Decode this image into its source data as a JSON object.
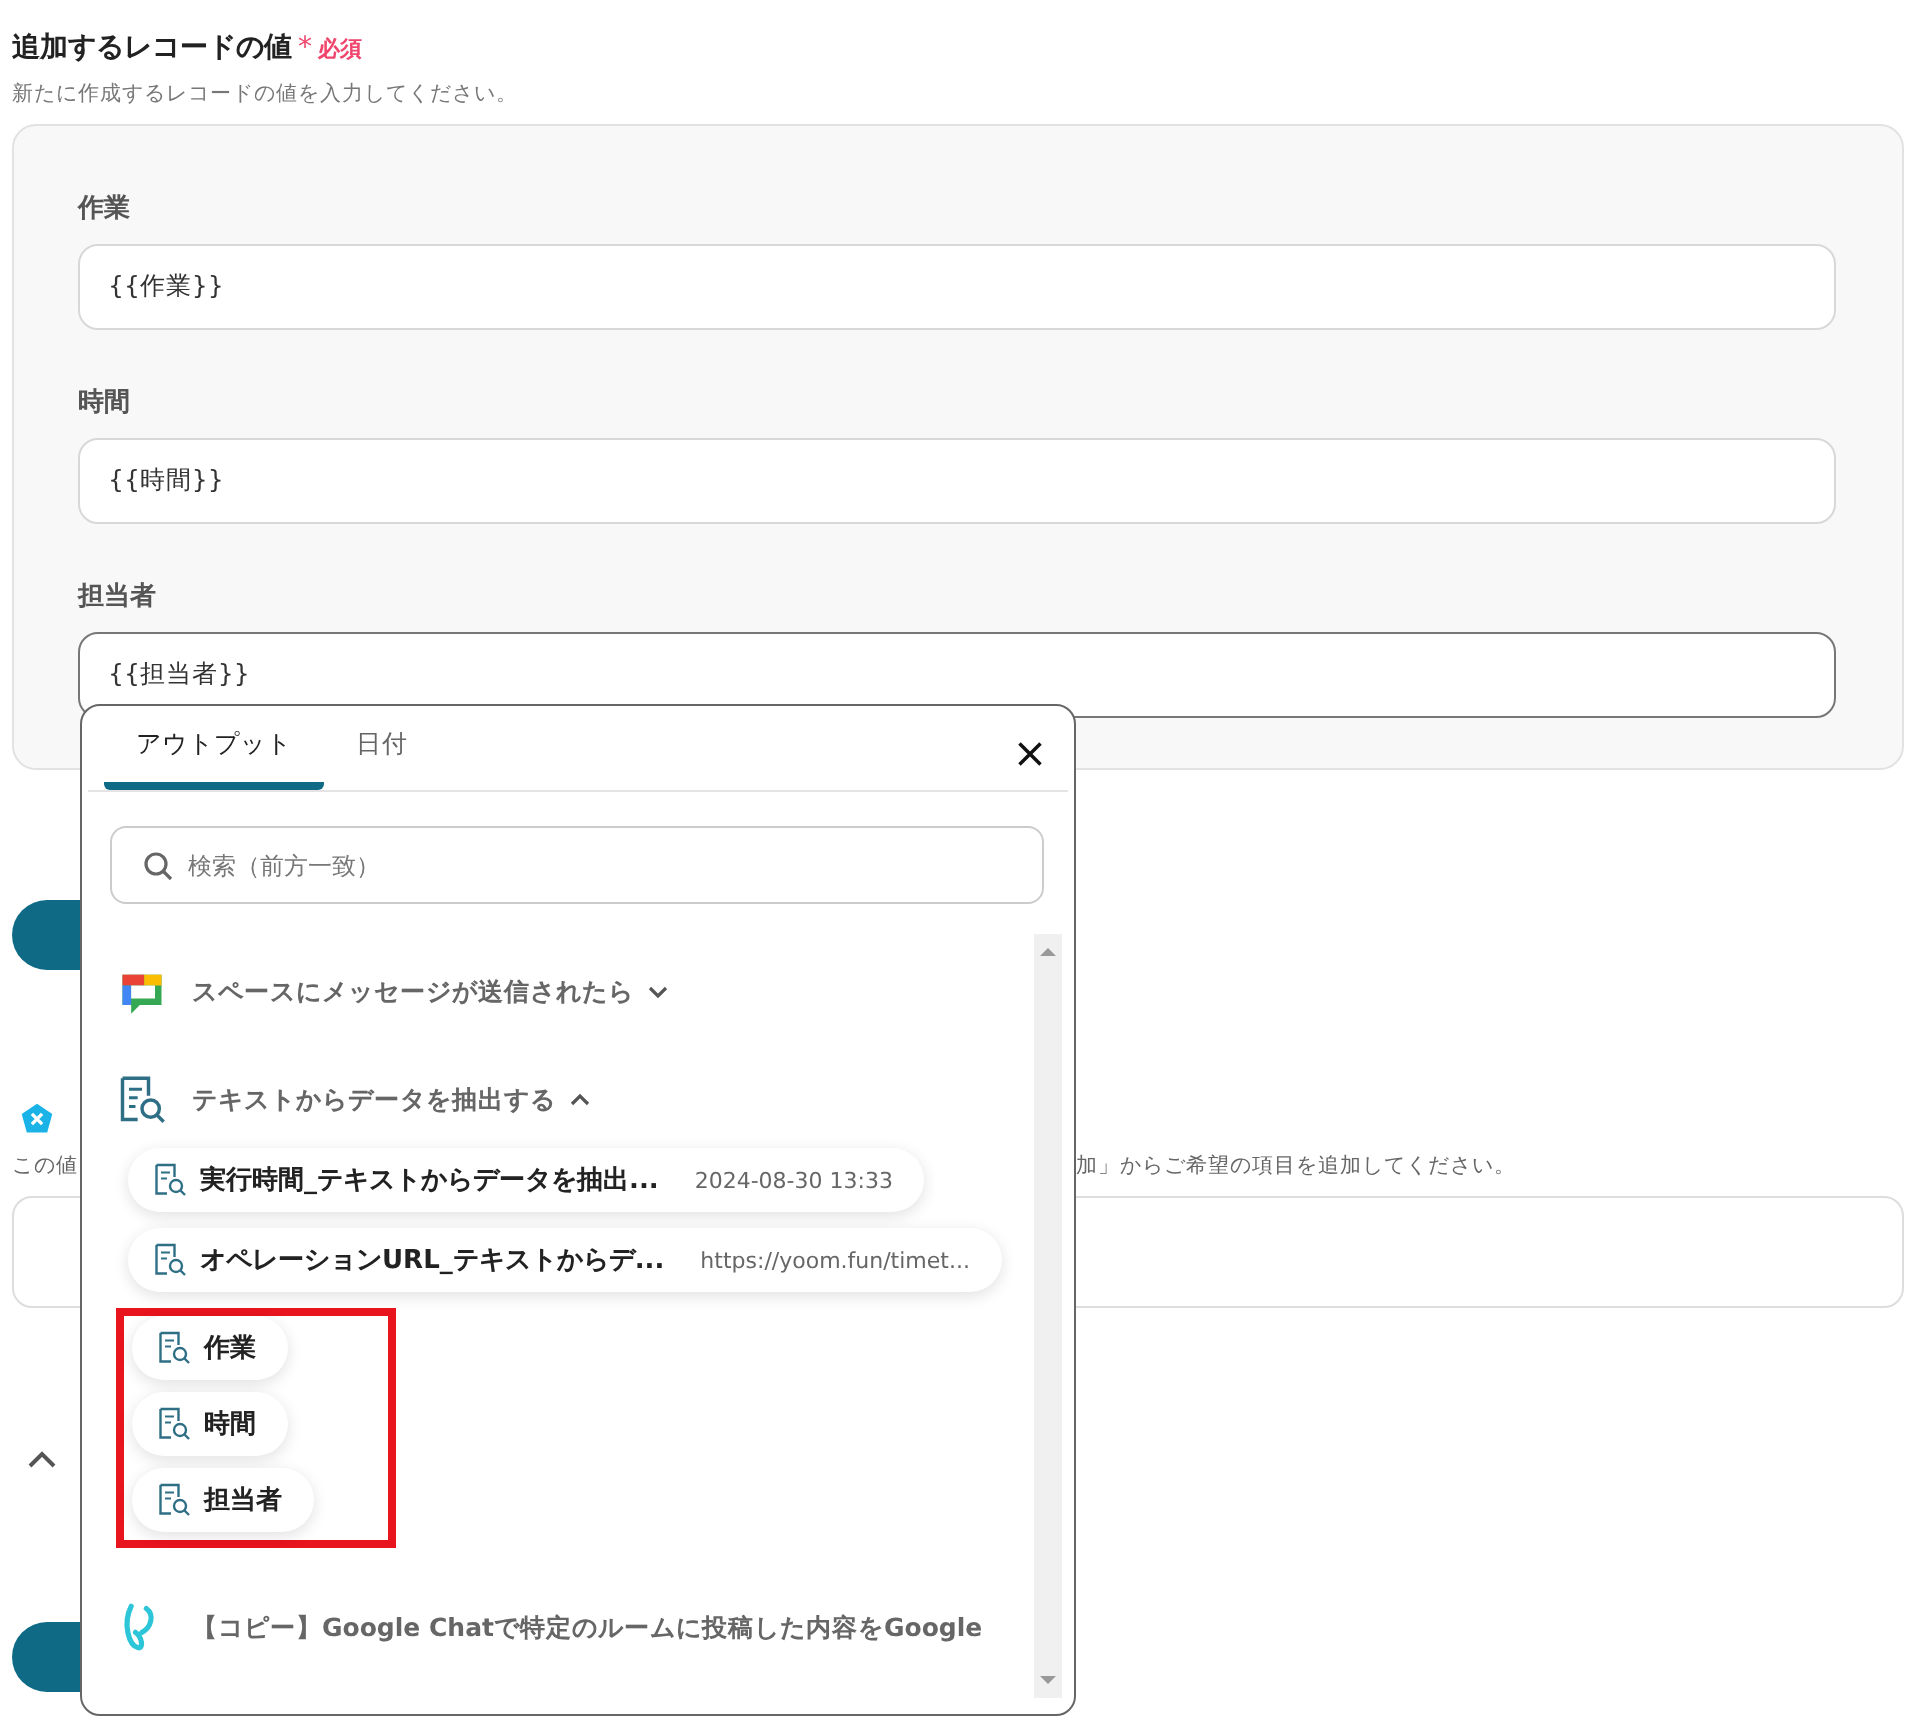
{
  "section": {
    "title": "追加するレコードの値",
    "required_mark": "*",
    "required": "必須",
    "description": "新たに作成するレコードの値を入力してください。",
    "fields": [
      {
        "label": "作業",
        "value": "{{作業}}",
        "focused": false
      },
      {
        "label": "時間",
        "value": "{{時間}}",
        "focused": false
      },
      {
        "label": "担当者",
        "value": "{{担当者}}",
        "focused": true
      }
    ]
  },
  "section2": {
    "hint_start": "この値",
    "hint_end": "加」からご希望の項目を追加してください。"
  },
  "popup": {
    "tabs": [
      {
        "label": "アウトプット",
        "selected": true
      },
      {
        "label": "日付",
        "selected": false
      }
    ],
    "search": {
      "placeholder": "検索（前方一致）"
    },
    "groups": [
      {
        "kind": "chat",
        "title": "スペースにメッセージが送信されたら",
        "expanded": false
      },
      {
        "kind": "extract",
        "title": "テキストからデータを抽出する",
        "expanded": true,
        "children": [
          {
            "name": "実行時間_テキストからデータを抽出...",
            "value": "2024-08-30 13:33"
          },
          {
            "name": "オペレーションURL_テキストからデ...",
            "value": "https://yoom.fun/timet..."
          }
        ],
        "highlighted_children": [
          {
            "name": "作業"
          },
          {
            "name": "時間"
          },
          {
            "name": "担当者"
          }
        ]
      },
      {
        "kind": "flow",
        "title": "【コピー】Google Chatで特定のルームに投稿した内容をGoogle"
      }
    ]
  }
}
